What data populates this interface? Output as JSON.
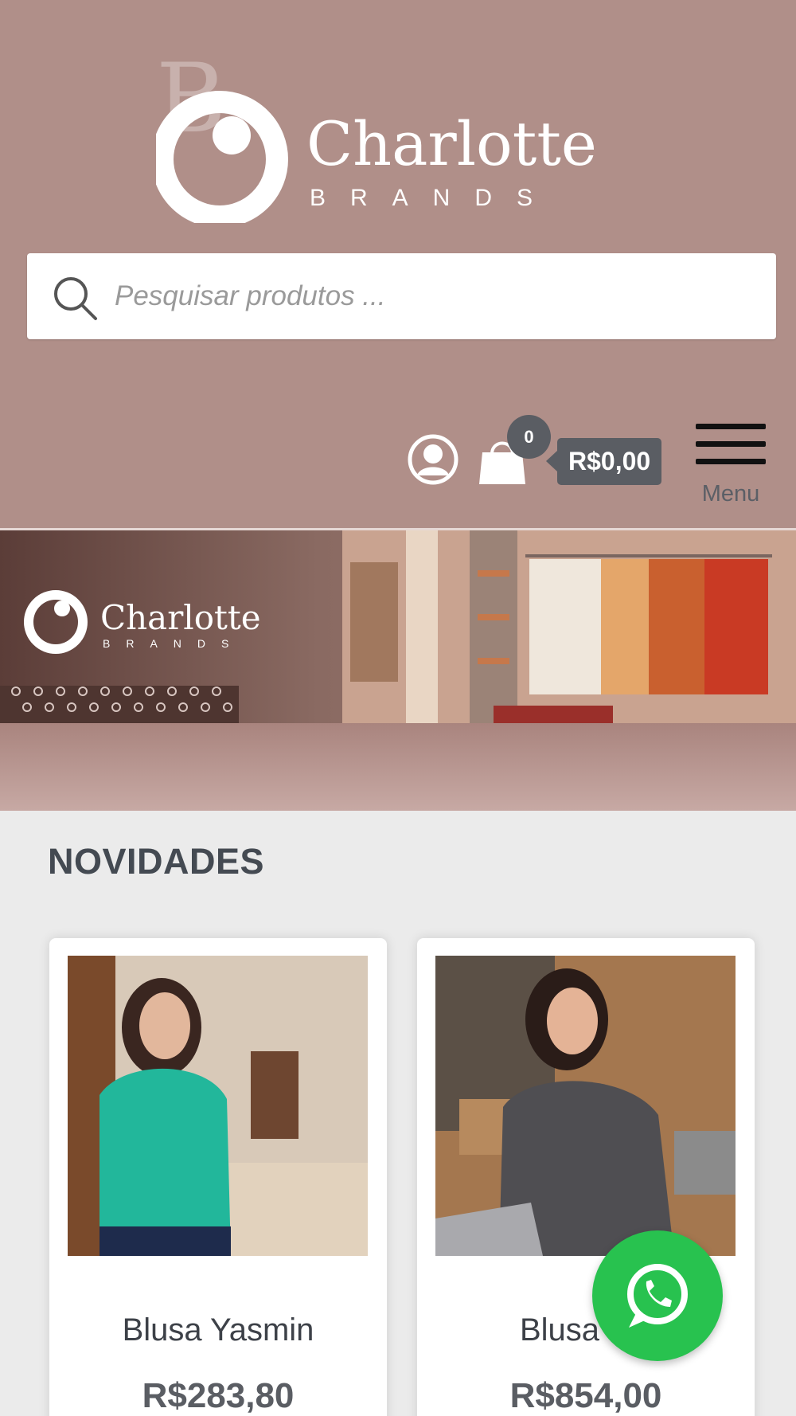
{
  "brand": {
    "name": "Charlotte",
    "tagline": "BRANDS"
  },
  "search": {
    "placeholder": "Pesquisar produtos ..."
  },
  "header": {
    "cart_count": "0",
    "cart_total": "R$0,00",
    "menu_label": "Menu"
  },
  "banner": {
    "brand_name": "Charlotte",
    "brand_tagline": "BRANDS"
  },
  "section": {
    "title": "NOVIDADES"
  },
  "products": [
    {
      "name": "Blusa Yasmin",
      "price": "R$283,80"
    },
    {
      "name": "Blusa Val",
      "price": "R$854,00"
    }
  ],
  "colors": {
    "header_bg": "#b08f89",
    "badge": "#5a5d63",
    "whatsapp": "#28c24f"
  },
  "icons": {
    "search": "magnifier-icon",
    "account": "user-circle-icon",
    "cart": "shopping-bag-icon",
    "menu": "hamburger-icon",
    "chat": "whatsapp-icon"
  }
}
